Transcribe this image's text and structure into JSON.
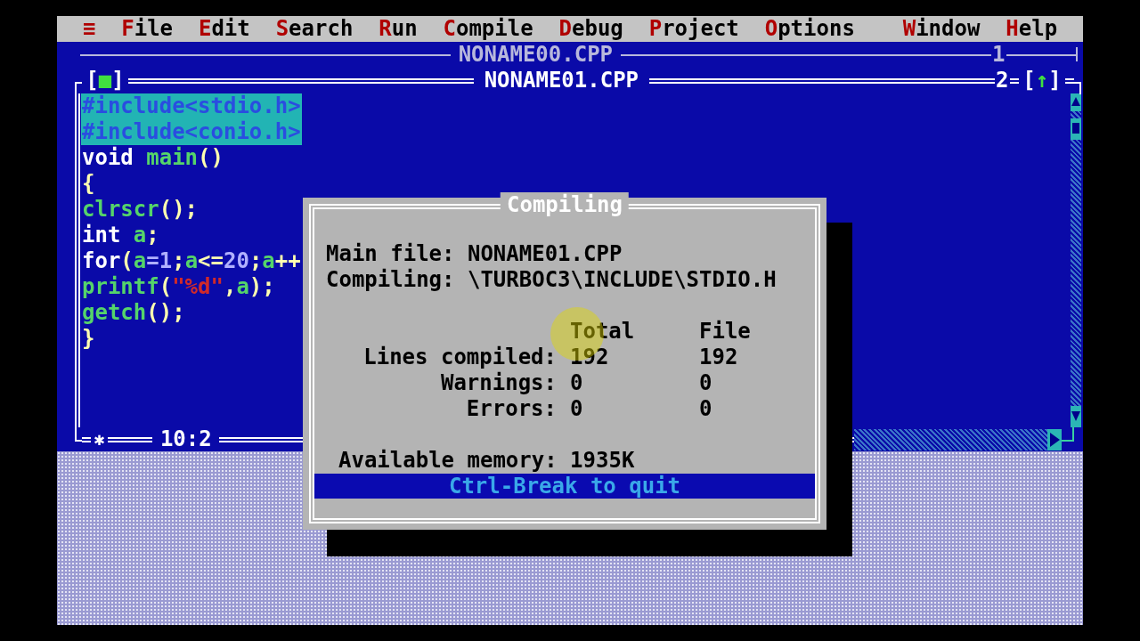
{
  "menu": {
    "system_icon": "≡",
    "items": [
      {
        "label": "File"
      },
      {
        "label": "Edit"
      },
      {
        "label": "Search"
      },
      {
        "label": "Run"
      },
      {
        "label": "Compile"
      },
      {
        "label": "Debug"
      },
      {
        "label": "Project"
      },
      {
        "label": "Options"
      }
    ],
    "right_items": [
      {
        "label": "Window"
      },
      {
        "label": "Help"
      }
    ]
  },
  "back_window": {
    "title": "NONAME00.CPP",
    "number": "1"
  },
  "editor": {
    "title": "NONAME01.CPP",
    "close_box": "[■]",
    "number": "2",
    "zoom_box": "[↑]",
    "modified_marker": "✱",
    "cursor_position": "10:2",
    "lines": [
      {
        "selected": true,
        "tokens": [
          {
            "kind": "pre",
            "text": "#include<stdio.h>"
          }
        ]
      },
      {
        "selected": true,
        "tokens": [
          {
            "kind": "pre",
            "text": "#include<conio.h>"
          }
        ]
      },
      {
        "selected": false,
        "tokens": [
          {
            "kind": "plain",
            "text": "void "
          },
          {
            "kind": "func",
            "text": "main"
          },
          {
            "kind": "sym",
            "text": "()"
          }
        ]
      },
      {
        "selected": false,
        "tokens": [
          {
            "kind": "sym",
            "text": "{"
          }
        ]
      },
      {
        "selected": false,
        "tokens": [
          {
            "kind": "func",
            "text": "clrscr"
          },
          {
            "kind": "sym",
            "text": "();"
          }
        ]
      },
      {
        "selected": false,
        "tokens": [
          {
            "kind": "plain",
            "text": "int "
          },
          {
            "kind": "func",
            "text": "a"
          },
          {
            "kind": "sym",
            "text": ";"
          }
        ]
      },
      {
        "selected": false,
        "tokens": [
          {
            "kind": "plain",
            "text": "for"
          },
          {
            "kind": "sym",
            "text": "("
          },
          {
            "kind": "func",
            "text": "a"
          },
          {
            "kind": "num",
            "text": "=1"
          },
          {
            "kind": "sym",
            "text": ";"
          },
          {
            "kind": "func",
            "text": "a"
          },
          {
            "kind": "sym",
            "text": "<="
          },
          {
            "kind": "num",
            "text": "20"
          },
          {
            "kind": "sym",
            "text": ";"
          },
          {
            "kind": "func",
            "text": "a"
          },
          {
            "kind": "sym",
            "text": "++"
          }
        ]
      },
      {
        "selected": false,
        "tokens": [
          {
            "kind": "func",
            "text": "printf"
          },
          {
            "kind": "sym",
            "text": "("
          },
          {
            "kind": "str",
            "text": "\"%d\""
          },
          {
            "kind": "sym",
            "text": ","
          },
          {
            "kind": "func",
            "text": "a"
          },
          {
            "kind": "sym",
            "text": ");"
          }
        ]
      },
      {
        "selected": false,
        "tokens": [
          {
            "kind": "func",
            "text": "getch"
          },
          {
            "kind": "sym",
            "text": "();"
          }
        ]
      },
      {
        "selected": false,
        "tokens": [
          {
            "kind": "sym",
            "text": "}"
          }
        ]
      }
    ]
  },
  "dialog": {
    "title": "Compiling",
    "fields": [
      {
        "label": "Main file:",
        "value": "NONAME01.CPP"
      },
      {
        "label": "Compiling:",
        "value": "\\TURBOC3\\INCLUDE\\STDIO.H"
      }
    ],
    "stats": {
      "columns": [
        "Total",
        "File"
      ],
      "rows": [
        {
          "label": "Lines compiled:",
          "total": "192",
          "file": "192"
        },
        {
          "label": "Warnings:",
          "total": "0",
          "file": "0"
        },
        {
          "label": "Errors:",
          "total": "0",
          "file": "0"
        }
      ]
    },
    "memory": {
      "label": "Available memory:",
      "value": "1935K"
    },
    "footer": "Ctrl-Break to quit"
  }
}
